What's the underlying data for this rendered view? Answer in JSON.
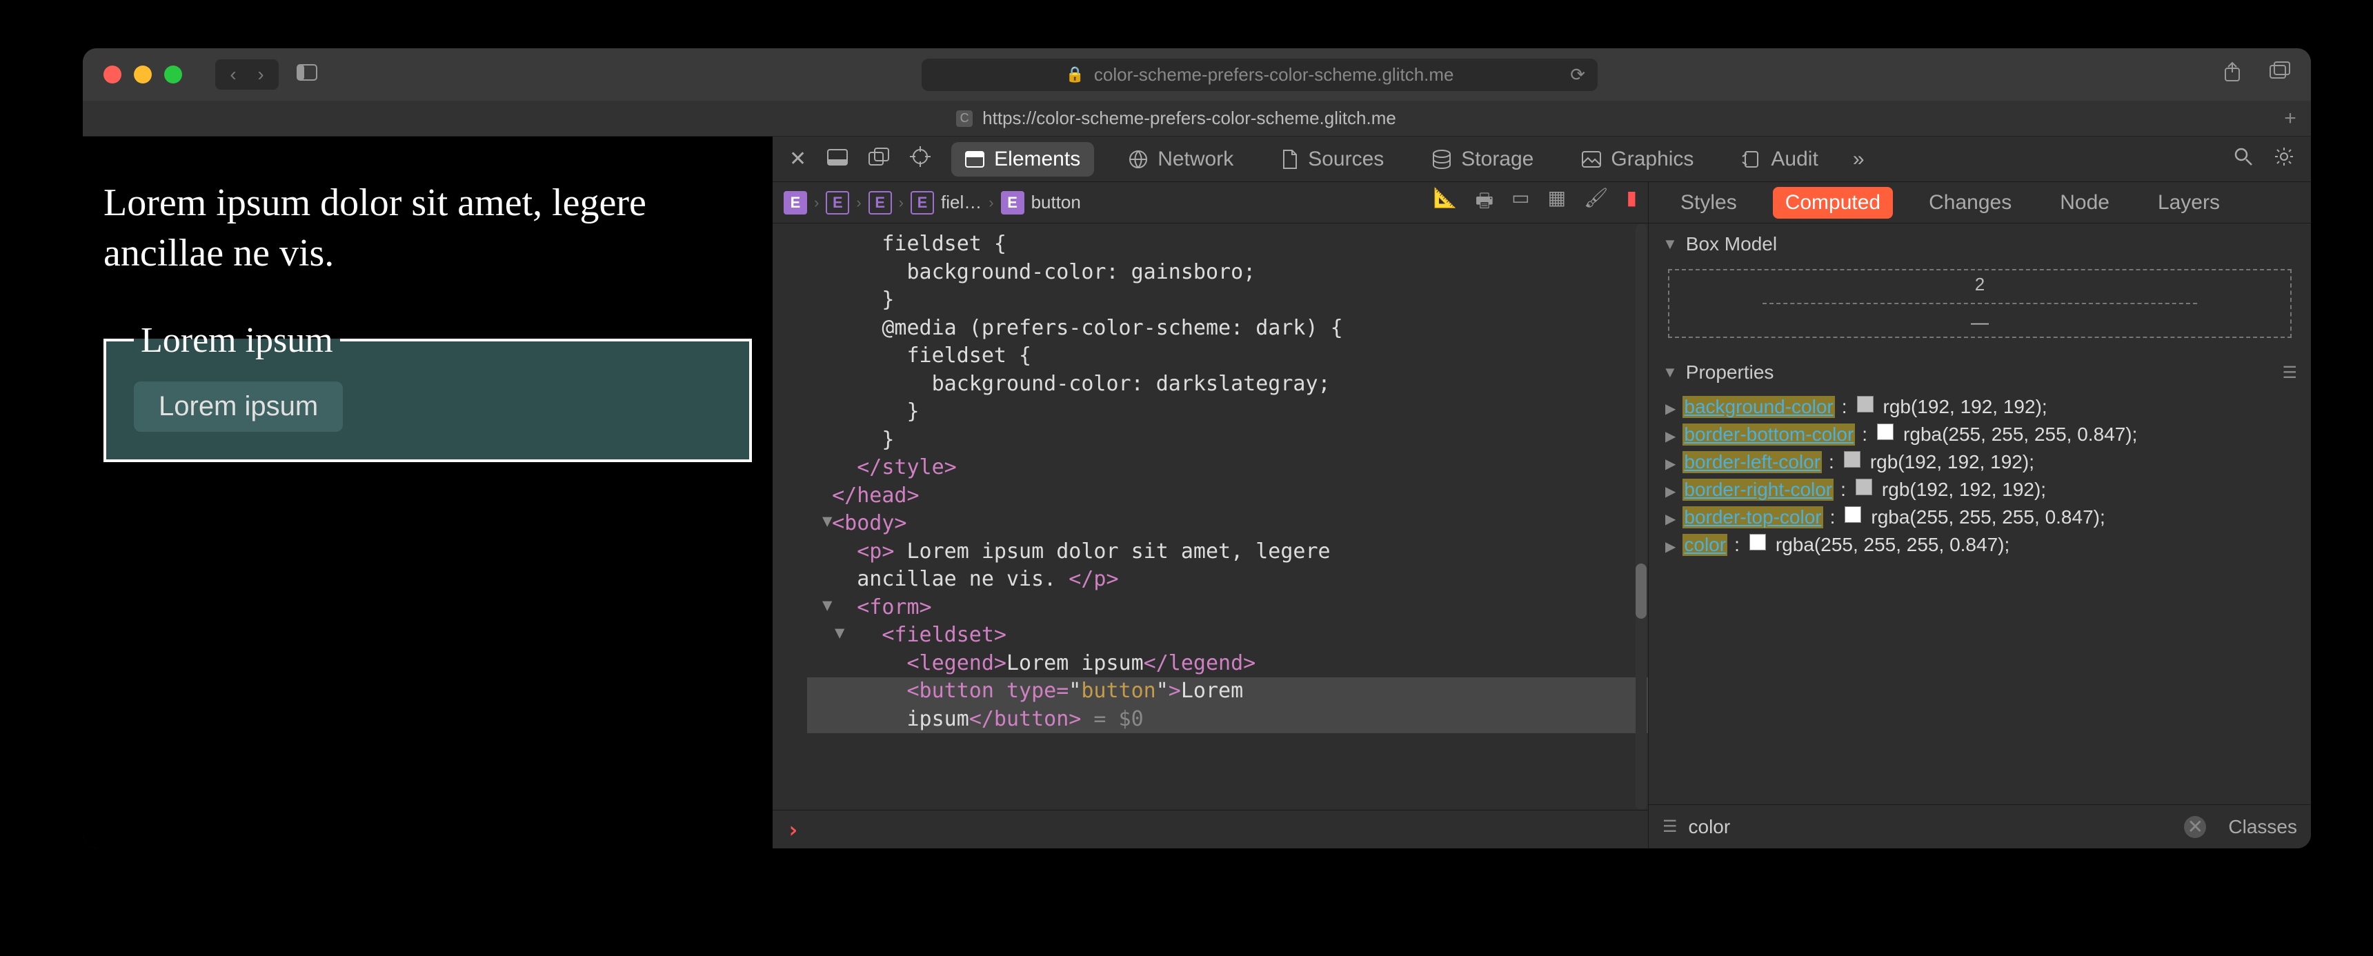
{
  "titlebar": {
    "url_host": "color-scheme-prefers-color-scheme.glitch.me"
  },
  "tab": {
    "label": "https://color-scheme-prefers-color-scheme.glitch.me"
  },
  "page": {
    "paragraph": "Lorem ipsum dolor sit amet, legere ancillae ne vis.",
    "legend": "Lorem ipsum",
    "button": "Lorem ipsum"
  },
  "devtools": {
    "tabs": {
      "elements": "Elements",
      "network": "Network",
      "sources": "Sources",
      "storage": "Storage",
      "graphics": "Graphics",
      "audit": "Audit"
    },
    "breadcrumb": {
      "fieldset": "fiel…",
      "button": "button"
    },
    "code": {
      "l1": "      fieldset {",
      "l2": "        background-color: gainsboro;",
      "l3": "      }",
      "l4": "      @media (prefers-color-scheme: dark) {",
      "l5": "        fieldset {",
      "l6": "          background-color: darkslategray;",
      "l7": "        }",
      "l8": "      }",
      "l9": "    </style>",
      "l10": "  </head>",
      "l11": "  <body>",
      "l12": "    <p> Lorem ipsum dolor sit amet, legere",
      "l12b": "    ancillae ne vis. </p>",
      "l13": "    <form>",
      "l14": "      <fieldset>",
      "l15a": "        <legend>",
      "l15b": "Lorem ipsum",
      "l15c": "</legend>",
      "l16a": "        <button type=\"",
      "l16b": "button",
      "l16c": "\">",
      "l16d": "Lorem",
      "l17a": "        ipsum",
      "l17b": "</button>",
      "l17c": " = $0"
    },
    "side_tabs": {
      "styles": "Styles",
      "computed": "Computed",
      "changes": "Changes",
      "node": "Node",
      "layers": "Layers"
    },
    "sections": {
      "boxmodel": "Box Model",
      "properties": "Properties"
    },
    "boxmodel": {
      "top": "2",
      "mid": "—"
    },
    "props": [
      {
        "name": "background-color",
        "swatch": "#c0c0c0",
        "value": "rgb(192, 192, 192)"
      },
      {
        "name": "border-bottom-color",
        "swatch": "#ffffff",
        "value": "rgba(255, 255, 255, 0.847)"
      },
      {
        "name": "border-left-color",
        "swatch": "#c0c0c0",
        "value": "rgb(192, 192, 192)"
      },
      {
        "name": "border-right-color",
        "swatch": "#c0c0c0",
        "value": "rgb(192, 192, 192)"
      },
      {
        "name": "border-top-color",
        "swatch": "#ffffff",
        "value": "rgba(255, 255, 255, 0.847)"
      },
      {
        "name": "color",
        "swatch": "#ffffff",
        "value": "rgba(255, 255, 255, 0.847)"
      }
    ],
    "filter": {
      "value": "color",
      "classes": "Classes"
    }
  }
}
